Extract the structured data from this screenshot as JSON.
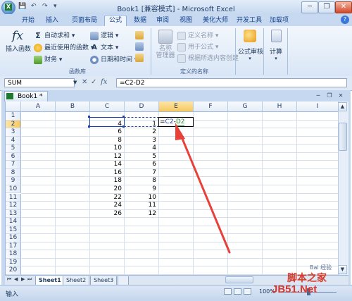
{
  "window": {
    "title": "Book1 [兼容模式] - Microsoft Excel",
    "office_button": "X",
    "qat": [
      "💾",
      "↶",
      "↷",
      "▾"
    ],
    "controls": [
      "─",
      "❐",
      "✕"
    ]
  },
  "ribbon": {
    "tabs": [
      "开始",
      "插入",
      "页面布局",
      "公式",
      "数据",
      "审阅",
      "视图",
      "美化大师",
      "开发工具",
      "加载项"
    ],
    "active_tab": "公式",
    "function_library": {
      "insert_function": "插入函数",
      "insert_function_glyph": "fx",
      "autosum": "自动求和 ▾",
      "recent": "最近使用的函数 ▾",
      "financial": "财务 ▾",
      "logical": "逻辑 ▾",
      "text": "文本 ▾",
      "datetime": "日期和时间 ▾",
      "group_label": "函数库"
    },
    "defined_names": {
      "name_manager": "名称\n管理器",
      "define_name": "定义名称 ▾",
      "use_in_formula": "用于公式 ▾",
      "create_from_selection": "根据所选内容创建",
      "group_label": "定义的名称"
    },
    "auditing": {
      "label": "公式审核"
    },
    "calculation": {
      "label": "计算"
    }
  },
  "formula_bar": {
    "name_box": "SUM",
    "cancel": "✕",
    "enter": "✓",
    "fx": "fx",
    "content": "=C2-D2"
  },
  "workbook": {
    "title": "Book1 *",
    "controls": [
      "─",
      "❐",
      "✕"
    ]
  },
  "grid": {
    "columns": [
      "A",
      "B",
      "C",
      "D",
      "E",
      "F",
      "G",
      "H",
      "I"
    ],
    "rows": [
      "1",
      "2",
      "3",
      "4",
      "5",
      "6",
      "7",
      "8",
      "9",
      "10",
      "11",
      "12",
      "13",
      "14",
      "15",
      "16",
      "17",
      "18",
      "19",
      "20"
    ],
    "C": [
      "",
      "4",
      "6",
      "8",
      "10",
      "12",
      "14",
      "16",
      "18",
      "20",
      "22",
      "24",
      "26"
    ],
    "D": [
      "",
      "1",
      "2",
      "3",
      "4",
      "5",
      "6",
      "7",
      "8",
      "9",
      "10",
      "11",
      "12"
    ],
    "editing_prefix": "=",
    "editing_ref1": "C2",
    "editing_op": "-",
    "editing_ref2": "D2",
    "active_cell": "E2"
  },
  "sheets": {
    "tabs": [
      "Sheet1",
      "Sheet2",
      "Sheet3"
    ],
    "active": "Sheet1",
    "nav": [
      "⏮",
      "◀",
      "▶",
      "⏭"
    ]
  },
  "status": {
    "mode": "输入",
    "zoom": "100%"
  },
  "watermark": {
    "line1": "脚本之家",
    "line2": "JB51.Net",
    "baidu": "Bai 经验"
  },
  "colors": {
    "arrow": "#e8413a",
    "ref_blue": "#1a3fb8",
    "ref_green": "#1f8f2e"
  }
}
